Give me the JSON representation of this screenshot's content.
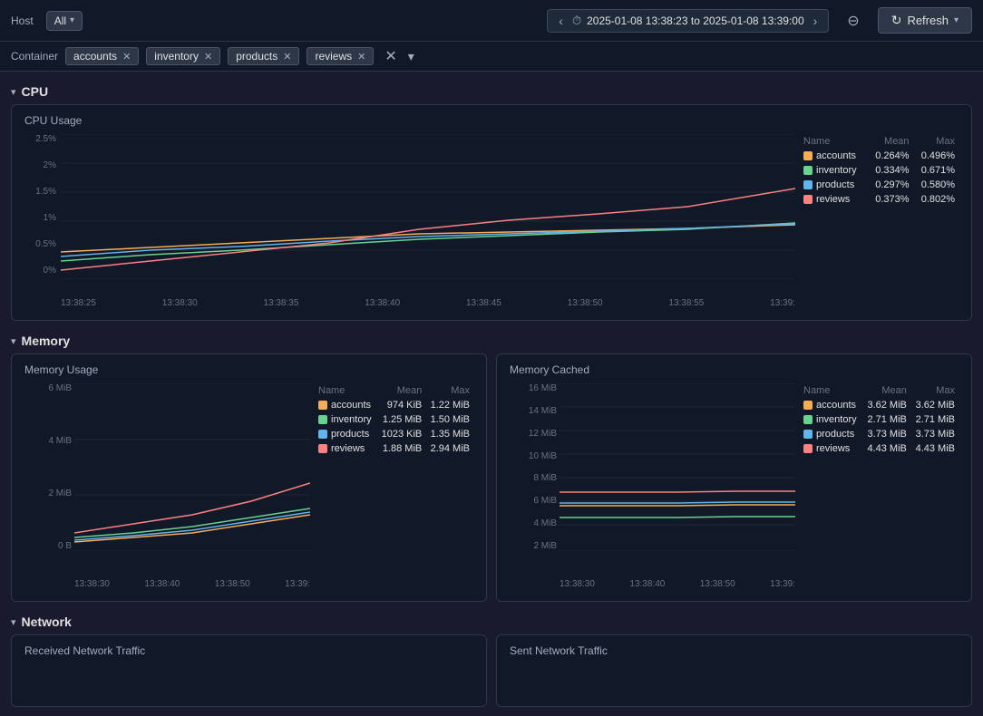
{
  "topbar": {
    "host_label": "Host",
    "all_label": "All",
    "time_range": "2025-01-08 13:38:23 to 2025-01-08 13:39:00",
    "refresh_label": "Refresh"
  },
  "filters": {
    "container_label": "Container",
    "tags": [
      "accounts",
      "inventory",
      "products",
      "reviews"
    ]
  },
  "cpu": {
    "section_title": "CPU",
    "chart_title": "CPU Usage",
    "y_labels": [
      "2.5%",
      "2%",
      "1.5%",
      "1%",
      "0.5%",
      "0%"
    ],
    "x_labels": [
      "13:38:25",
      "13:38:30",
      "13:38:35",
      "13:38:40",
      "13:38:45",
      "13:38:50",
      "13:38:55",
      "13:39:"
    ],
    "legend": {
      "headers": [
        "Name",
        "Mean",
        "Max"
      ],
      "rows": [
        {
          "name": "accounts",
          "color": "#f6ad55",
          "mean": "0.264%",
          "max": "0.496%"
        },
        {
          "name": "inventory",
          "color": "#68d391",
          "mean": "0.334%",
          "max": "0.671%"
        },
        {
          "name": "products",
          "color": "#63b3ed",
          "mean": "0.297%",
          "max": "0.580%"
        },
        {
          "name": "reviews",
          "color": "#fc8181",
          "mean": "0.373%",
          "max": "0.802%"
        }
      ]
    }
  },
  "memory": {
    "section_title": "Memory",
    "usage": {
      "chart_title": "Memory Usage",
      "y_labels": [
        "6 MiB",
        "4 MiB",
        "2 MiB",
        "0 B"
      ],
      "x_labels": [
        "13:38:30",
        "13:38:40",
        "13:38:50",
        "13:39:"
      ],
      "legend": {
        "headers": [
          "Name",
          "Mean",
          "Max"
        ],
        "rows": [
          {
            "name": "accounts",
            "color": "#f6ad55",
            "mean": "974 KiB",
            "max": "1.22 MiB"
          },
          {
            "name": "inventory",
            "color": "#68d391",
            "mean": "1.25 MiB",
            "max": "1.50 MiB"
          },
          {
            "name": "products",
            "color": "#63b3ed",
            "mean": "1023 KiB",
            "max": "1.35 MiB"
          },
          {
            "name": "reviews",
            "color": "#fc8181",
            "mean": "1.88 MiB",
            "max": "2.94 MiB"
          }
        ]
      }
    },
    "cached": {
      "chart_title": "Memory Cached",
      "y_labels": [
        "16 MiB",
        "14 MiB",
        "12 MiB",
        "10 MiB",
        "8 MiB",
        "6 MiB",
        "4 MiB",
        "2 MiB"
      ],
      "x_labels": [
        "13:38:30",
        "13:38:40",
        "13:38:50",
        "13:39:"
      ],
      "legend": {
        "headers": [
          "Name",
          "Mean",
          "Max"
        ],
        "rows": [
          {
            "name": "accounts",
            "color": "#f6ad55",
            "mean": "3.62 MiB",
            "max": "3.62 MiB"
          },
          {
            "name": "inventory",
            "color": "#68d391",
            "mean": "2.71 MiB",
            "max": "2.71 MiB"
          },
          {
            "name": "products",
            "color": "#63b3ed",
            "mean": "3.73 MiB",
            "max": "3.73 MiB"
          },
          {
            "name": "reviews",
            "color": "#fc8181",
            "mean": "4.43 MiB",
            "max": "4.43 MiB"
          }
        ]
      }
    }
  },
  "network": {
    "section_title": "Network",
    "received_title": "Received Network Traffic",
    "sent_title": "Sent Network Traffic"
  }
}
